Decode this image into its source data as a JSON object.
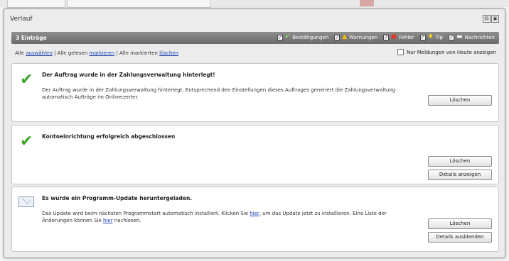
{
  "window": {
    "title": "Verlauf"
  },
  "toolbar": {
    "count_label": "3 Einträge",
    "filters": [
      {
        "label": "Bestätigungen",
        "icon": "checkmark-icon",
        "color": "#4caf2a"
      },
      {
        "label": "Warnungen",
        "icon": "warning-icon",
        "color": "#e8b400"
      },
      {
        "label": "Fehler",
        "icon": "error-icon",
        "color": "#d93025"
      },
      {
        "label": "Tip",
        "icon": "lightbulb-icon",
        "color": "#f2c200"
      },
      {
        "label": "Nachrichten",
        "icon": "message-icon",
        "color": "#ffffff"
      }
    ]
  },
  "actions": {
    "prefix1": "Alle",
    "select_link": "auswählen",
    "sep1": " | Alle gelesen",
    "mark_link": "markieren",
    "sep2": " | Alle markierten",
    "delete_link": "löschen"
  },
  "today_only_label": "Nur Meldungen von Heute anzeigen",
  "entries": [
    {
      "icon": "checkmark-icon",
      "title": "Der Auftrag wurde in der Zahlungsverwaltung hinterlegt!",
      "body": "Der Auftrag wurde in der Zahlungsverwaltung hinterlegt. Entsprechend den Einstellungen dieses Auftrages generiert die Zahlungsverwaltung automatisch Aufträge im Onlinecenter.",
      "buttons": [
        "Löschen"
      ]
    },
    {
      "icon": "checkmark-icon",
      "title": "Kontoeinrichtung erfolgreich abgeschlossen",
      "body": "",
      "buttons": [
        "Löschen",
        "Details anzeigen"
      ]
    },
    {
      "icon": "envelope-icon",
      "title": "Es wurde ein Programm-Update heruntergeladen.",
      "body_before": "Das Update wird beim nächsten Programmstart automatisch installiert. Klicken Sie ",
      "body_link1": "hier",
      "body_middle": ", um das Update jetzt zu installieren. Eine Liste der Änderungen können Sie ",
      "body_link2": "hier",
      "body_after": " nachlesen.",
      "buttons": [
        "Löschen",
        "Details ausblenden"
      ]
    }
  ]
}
